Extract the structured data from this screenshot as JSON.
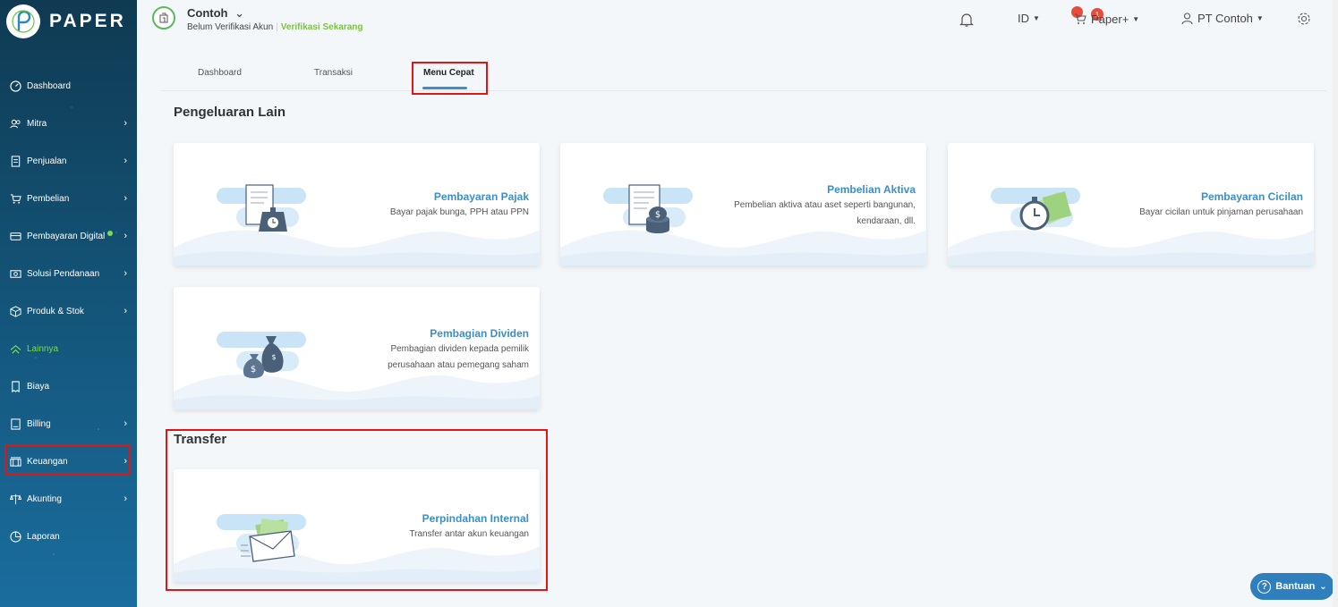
{
  "app": {
    "logo_text": "PAPER"
  },
  "company": {
    "name": "Contoh",
    "status": "Belum Verifikasi Akun",
    "verify_link": "Verifikasi Sekarang"
  },
  "topbar": {
    "notif_count": "1",
    "language": "ID",
    "paper_plus": "Paper+",
    "user": "PT Contoh"
  },
  "sidebar": {
    "items": [
      {
        "label": "Dashboard",
        "icon": "dashboard-icon"
      },
      {
        "label": "Mitra",
        "icon": "users-icon"
      },
      {
        "label": "Penjualan",
        "icon": "document-icon"
      },
      {
        "label": "Pembelian",
        "icon": "cart-icon"
      },
      {
        "label": "Pembayaran Digital",
        "icon": "card-icon"
      },
      {
        "label": "Solusi Pendanaan",
        "icon": "money-icon"
      },
      {
        "label": "Produk & Stok",
        "icon": "box-icon"
      },
      {
        "label": "Lainnya",
        "icon": "lainnya-icon"
      },
      {
        "label": "Biaya",
        "icon": "receipt-icon"
      },
      {
        "label": "Billing",
        "icon": "billing-icon"
      },
      {
        "label": "Keuangan",
        "icon": "bank-icon"
      },
      {
        "label": "Akunting",
        "icon": "scale-icon"
      },
      {
        "label": "Laporan",
        "icon": "pie-icon"
      }
    ]
  },
  "tabs": [
    {
      "label": "Dashboard"
    },
    {
      "label": "Transaksi"
    },
    {
      "label": "Menu Cepat"
    }
  ],
  "sections": {
    "pengeluaran": "Pengeluaran Lain",
    "transfer": "Transfer"
  },
  "cards": [
    {
      "title": "Pembayaran Pajak",
      "desc": "Bayar pajak bunga, PPH atau PPN",
      "icon": "tax-scale-icon"
    },
    {
      "title": "Pembelian Aktiva",
      "desc": "Pembelian aktiva atau aset seperti bangunan, kendaraan, dll.",
      "icon": "asset-coins-icon"
    },
    {
      "title": "Pembayaran Cicilan",
      "desc": "Bayar cicilan untuk pinjaman perusahaan",
      "icon": "stopwatch-money-icon"
    },
    {
      "title": "Pembagian Dividen",
      "desc": "Pembagian dividen kepada pemilik perusahaan atau pemegang saham",
      "icon": "money-bags-icon"
    },
    {
      "title": "Perpindahan Internal",
      "desc": "Transfer antar akun keuangan",
      "icon": "envelope-money-icon"
    }
  ],
  "help": {
    "label": "Bantuan"
  },
  "colors": {
    "accent": "#3b8ecb",
    "active_nav": "#7ed957",
    "highlight": "#e01515"
  }
}
